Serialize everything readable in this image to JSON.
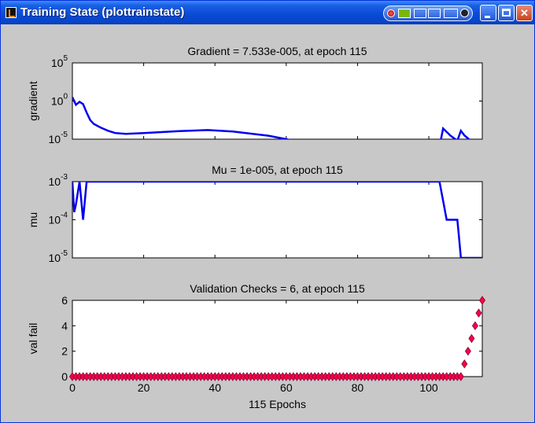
{
  "window": {
    "title": "Training State (plottrainstate)",
    "app_icon": "matlab-figure-icon",
    "controls": [
      "minimize-icon",
      "maximize-icon",
      "close-icon"
    ],
    "tray_icons": [
      "record-icon",
      "nvidia-icon",
      "pin-icon",
      "move-icon",
      "resize-icon",
      "menu-icon"
    ],
    "colors": {
      "titlebar": "#0a4ad6",
      "line": "#0000ee",
      "marker_fill": "#ff0040",
      "marker_edge": "#800040",
      "background": "#c8c8c8"
    }
  },
  "xlabel": "115 Epochs",
  "chart_data": [
    {
      "type": "line",
      "title": "Gradient = 7.533e-005, at epoch 115",
      "ylabel": "gradient",
      "log_y": true,
      "yticks": [
        {
          "base": "10",
          "exp": "5"
        },
        {
          "base": "10",
          "exp": "0"
        },
        {
          "base": "10",
          "exp": "-5"
        }
      ],
      "ylim_log10": [
        -5,
        5
      ],
      "xlim": [
        0,
        115
      ],
      "x": [
        0,
        1,
        2,
        3,
        4,
        5,
        6,
        8,
        10,
        12,
        15,
        20,
        30,
        38,
        45,
        55,
        60,
        65,
        70,
        75,
        80,
        90,
        95,
        100,
        103,
        104,
        106,
        108,
        109,
        110,
        112,
        115
      ],
      "log10": [
        0.5,
        -0.5,
        -0.1,
        -0.4,
        -1.5,
        -2.5,
        -3.0,
        -3.5,
        -3.9,
        -4.2,
        -4.3,
        -4.2,
        -3.95,
        -3.8,
        -4.0,
        -4.55,
        -5.0,
        -5.5,
        -5.7,
        -5.6,
        -5.3,
        -5.5,
        -5.7,
        -5.65,
        -6.0,
        -3.6,
        -4.5,
        -5.2,
        -3.9,
        -4.5,
        -5.3,
        -6.1
      ]
    },
    {
      "type": "line",
      "title": "Mu = 1e-005, at epoch 115",
      "ylabel": "mu",
      "log_y": true,
      "yticks": [
        {
          "base": "10",
          "exp": "-3"
        },
        {
          "base": "10",
          "exp": "-4"
        },
        {
          "base": "10",
          "exp": "-5"
        }
      ],
      "ylim_log10": [
        -5,
        -3
      ],
      "xlim": [
        0,
        115
      ],
      "x": [
        0,
        0.5,
        1,
        2,
        3,
        4,
        103,
        104,
        105,
        106,
        108,
        108.5,
        109,
        110,
        115
      ],
      "log10": [
        -3,
        -3.8,
        -3.6,
        -3,
        -4,
        -3,
        -3,
        -3.5,
        -4,
        -4,
        -4,
        -4.5,
        -5,
        -5,
        -5
      ]
    },
    {
      "type": "scatter",
      "title": "Validation Checks = 6, at epoch 115",
      "ylabel": "val fail",
      "xlim": [
        0,
        115
      ],
      "ylim": [
        0,
        6
      ],
      "yticks": [
        "0",
        "2",
        "4",
        "6"
      ],
      "xticks": [
        "0",
        "20",
        "40",
        "60",
        "80",
        "100"
      ],
      "zero_epochs_through": 109,
      "points": [
        [
          110,
          1
        ],
        [
          111,
          2
        ],
        [
          112,
          3
        ],
        [
          113,
          4
        ],
        [
          114,
          5
        ],
        [
          115,
          6
        ]
      ]
    }
  ]
}
